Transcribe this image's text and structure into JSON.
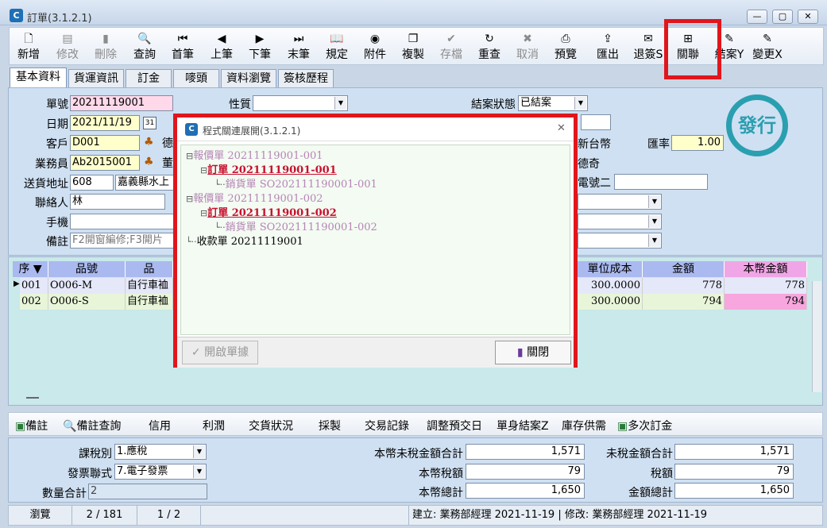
{
  "window": {
    "title": "訂單(3.1.2.1)",
    "min": "▭",
    "max": "▢",
    "close": "✕"
  },
  "toolbar": [
    {
      "label": "新增",
      "icon": "new-doc-icon",
      "glyph": "🗋",
      "enabled": true
    },
    {
      "label": "修改",
      "icon": "edit-icon",
      "glyph": "▤",
      "enabled": false
    },
    {
      "label": "刪除",
      "icon": "trash-icon",
      "glyph": "▮",
      "enabled": false
    },
    {
      "label": "查詢",
      "icon": "search-icon",
      "glyph": "🔍",
      "enabled": true
    },
    {
      "label": "首筆",
      "icon": "first-record-icon",
      "glyph": "⏮",
      "enabled": true
    },
    {
      "label": "上筆",
      "icon": "prev-record-icon",
      "glyph": "◀",
      "enabled": true
    },
    {
      "label": "下筆",
      "icon": "next-record-icon",
      "glyph": "▶",
      "enabled": true
    },
    {
      "label": "末筆",
      "icon": "last-record-icon",
      "glyph": "⏭",
      "enabled": true
    },
    {
      "label": "規定",
      "icon": "book-icon",
      "glyph": "📖",
      "enabled": true
    },
    {
      "label": "附件",
      "icon": "attachment-icon",
      "glyph": "◉",
      "enabled": true
    },
    {
      "label": "複製",
      "icon": "copy-icon",
      "glyph": "❐",
      "enabled": true
    },
    {
      "label": "存檔",
      "icon": "save-icon",
      "glyph": "✔",
      "enabled": false
    },
    {
      "label": "重查",
      "icon": "refresh-icon",
      "glyph": "↻",
      "enabled": true
    },
    {
      "label": "取消",
      "icon": "cancel-icon",
      "glyph": "✖",
      "enabled": false
    },
    {
      "label": "預覽",
      "icon": "print-preview-icon",
      "glyph": "⎙",
      "enabled": true
    },
    {
      "label": "匯出",
      "icon": "export-icon",
      "glyph": "⇪",
      "enabled": true
    },
    {
      "label": "退簽S",
      "icon": "unsign-icon",
      "glyph": "✉",
      "enabled": true
    },
    {
      "label": "關聯",
      "icon": "relation-tree-icon",
      "glyph": "⊞",
      "enabled": true
    },
    {
      "label": "結案Y",
      "icon": "close-case-icon",
      "glyph": "✎",
      "enabled": true
    },
    {
      "label": "變更X",
      "icon": "change-icon",
      "glyph": "✎",
      "enabled": true
    }
  ],
  "tabs": [
    "基本資料",
    "貨運資訊",
    "訂金",
    "嘜頭",
    "資料瀏覽",
    "簽核歷程"
  ],
  "form": {
    "order_no_label": "單號",
    "order_no": "20211119001",
    "date_label": "日期",
    "date": "2021/11/19",
    "calendar": "31",
    "customer_label": "客戶",
    "customer": "D001",
    "customer_name_partial": "德",
    "sales_label": "業務員",
    "sales": "Ab2015001",
    "sales_name_partial": "董",
    "address_label": "送貨地址",
    "address_code": "608",
    "address": "嘉義縣水上",
    "contact_label": "聯絡人",
    "contact": "林",
    "mobile_label": "手機",
    "remark_label": "備註",
    "remark_placeholder": "F2開窗編修;F3開片",
    "nature_label": "性質",
    "nature": "",
    "status_label": "結案狀態",
    "status": "已結案",
    "currency_partial": "新台幣",
    "rate_label": "匯率",
    "rate": "1.00",
    "company_partial": "德奇",
    "phone2_label_partial": "電號二",
    "stamp": "發行"
  },
  "grid": {
    "headers": [
      "序",
      "品號",
      "品",
      "單位成本",
      "金額",
      "本幣金額"
    ],
    "rows": [
      {
        "seq": "001",
        "item": "O006-M",
        "name": "自行車裇",
        "cost": "300.0000",
        "amount": "778",
        "base_amount": "778"
      },
      {
        "seq": "002",
        "item": "O006-S",
        "name": "自行車裇",
        "cost": "300.0000",
        "amount": "794",
        "base_amount": "794"
      }
    ]
  },
  "bottom_toolbar": [
    "備註",
    "備註查詢",
    "信用",
    "利潤",
    "交貨狀況",
    "採製",
    "交易記錄",
    "調整預交日",
    "單身結案Z",
    "庫存供需",
    "多次訂金"
  ],
  "summary": {
    "tax_type_label": "課稅別",
    "tax_type": "1.應稅",
    "invoice_label": "發票聯式",
    "invoice": "7.電子發票",
    "qty_label": "數量合計",
    "qty": "2",
    "base_untaxed_label": "本幣未稅金額合計",
    "base_untaxed": "1,571",
    "base_tax_label": "本幣稅額",
    "base_tax": "79",
    "base_total_label": "本幣總計",
    "base_total": "1,650",
    "untaxed_label": "未稅金額合計",
    "untaxed": "1,571",
    "tax_label": "稅額",
    "tax": "79",
    "total_label": "金額總計",
    "total": "1,650"
  },
  "status": {
    "mode": "瀏覽",
    "record": "2 / 181",
    "page": "1 / 2",
    "audit": "建立: 業務部經理 2021-11-19 | 修改: 業務部經理 2021-11-19"
  },
  "dialog": {
    "title": "程式關連展開(3.1.2.1)",
    "close": "✕",
    "nodes": [
      {
        "text": "報價單 20211119001-001",
        "kind": "q",
        "level": 0,
        "expander": "⊟"
      },
      {
        "text": "訂單 20211119001-001",
        "kind": "o",
        "level": 1,
        "expander": "⊟"
      },
      {
        "text": "銷貨單 SO202111190001-001",
        "kind": "q",
        "level": 2,
        "expander": ""
      },
      {
        "text": "報價單 20211119001-002",
        "kind": "q",
        "level": 0,
        "expander": "⊟"
      },
      {
        "text": "訂單 20211119001-002",
        "kind": "o",
        "level": 1,
        "expander": "⊟"
      },
      {
        "text": "銷貨單 SO202111190001-002",
        "kind": "q",
        "level": 2,
        "expander": ""
      },
      {
        "text": "收款單 20211119001",
        "kind": "k",
        "level": 0,
        "expander": ""
      }
    ],
    "open_btn": "開啟單據",
    "close_btn": "關閉"
  }
}
